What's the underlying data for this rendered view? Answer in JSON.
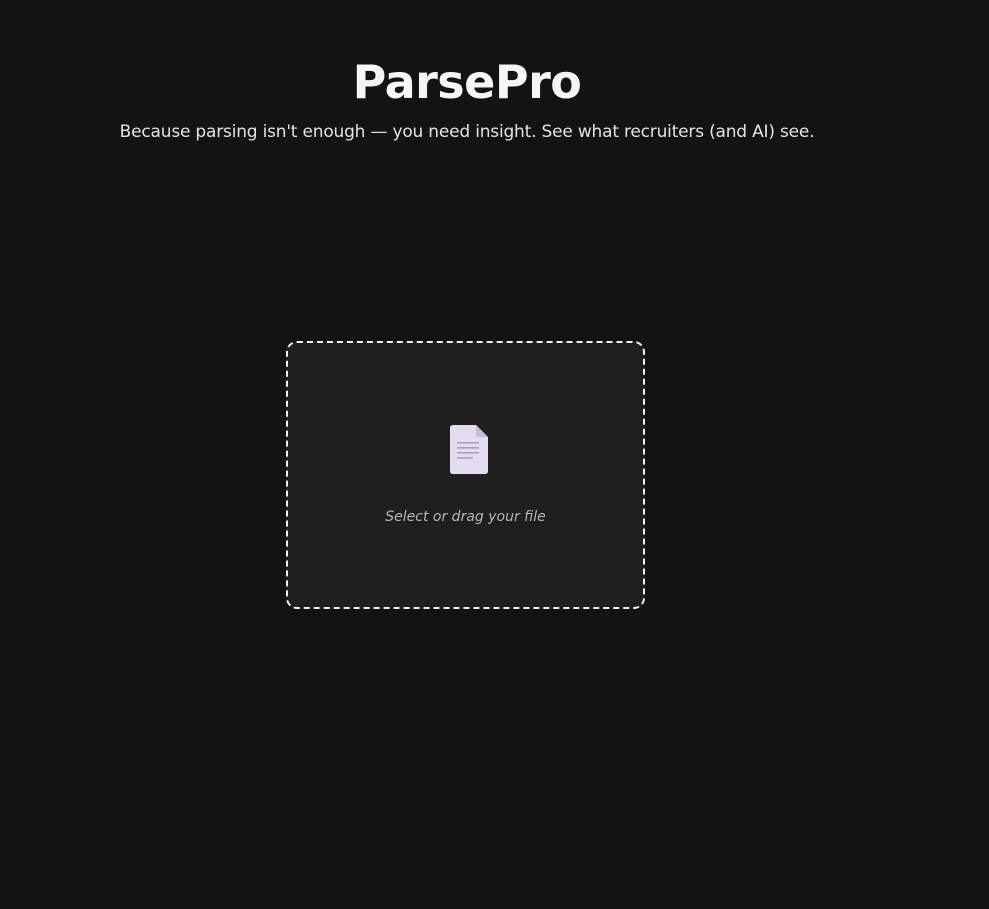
{
  "header": {
    "title": "ParsePro",
    "tagline": "Because parsing isn't enough — you need insight. See what recruiters (and AI) see."
  },
  "dropzone": {
    "label": "Select or drag your file",
    "icon": "document-icon",
    "border_color": "#f0f0f0",
    "background_color": "#1f1f1f"
  },
  "theme": {
    "page_background": "#131313",
    "icon_fill": "#e6dcf2"
  }
}
